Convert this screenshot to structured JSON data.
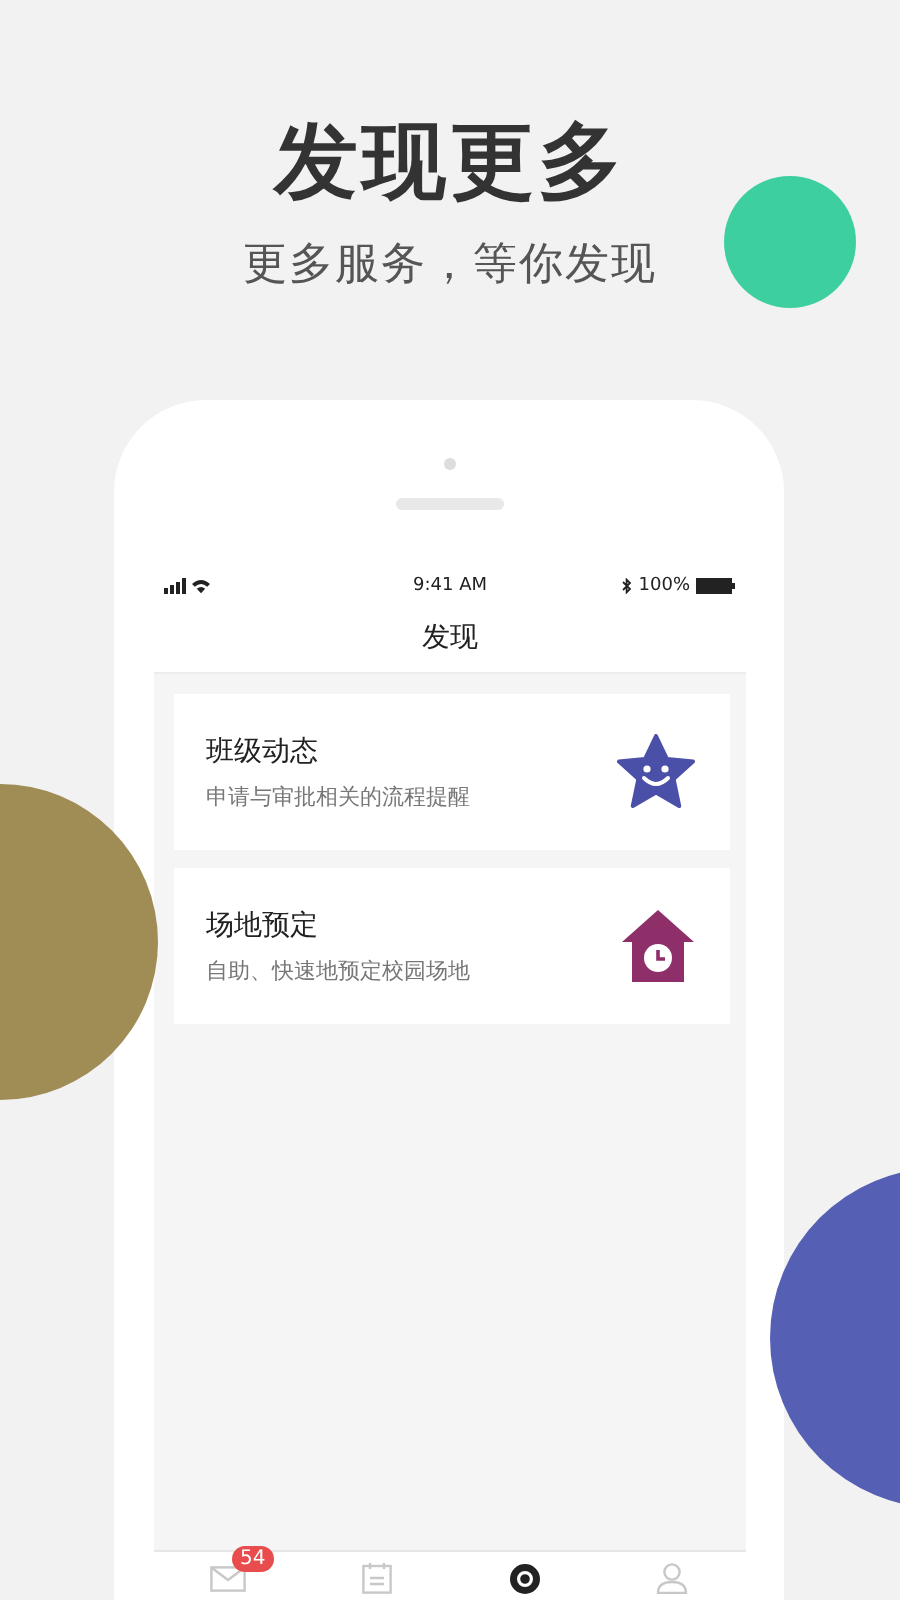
{
  "headline": "发现更多",
  "subtitle": "更多服务，等你发现",
  "status_bar": {
    "time": "9:41 AM",
    "battery": "100%"
  },
  "nav_title": "发现",
  "cards": [
    {
      "title": "班级动态",
      "description": "申请与审批相关的流程提醒",
      "kind": "star"
    },
    {
      "title": "场地预定",
      "description": "自助、快速地预定校园场地",
      "kind": "clock-house"
    }
  ],
  "tab_bar": [
    {
      "kind": "mail",
      "selected": false,
      "badge": "54"
    },
    {
      "kind": "calendar",
      "selected": false
    },
    {
      "kind": "discover",
      "selected": true
    },
    {
      "kind": "profile",
      "selected": false
    }
  ]
}
